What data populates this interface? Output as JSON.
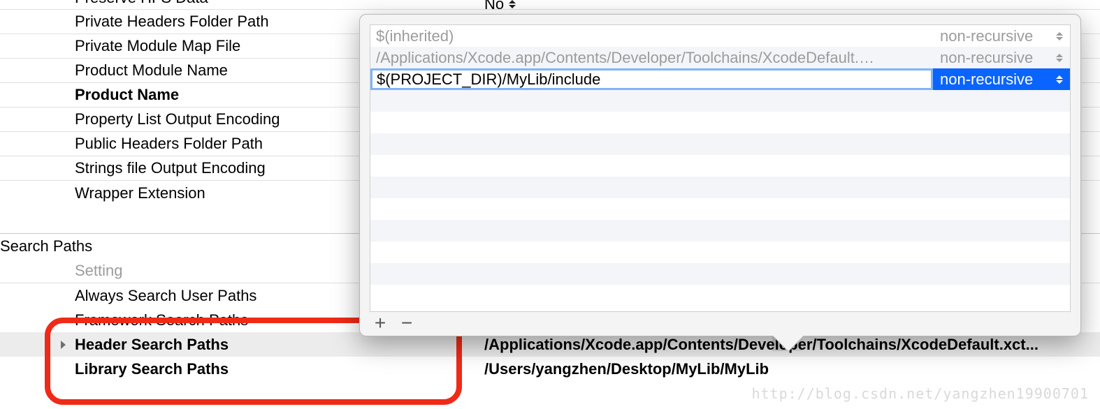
{
  "top_dropdown": {
    "value": "No"
  },
  "settings": {
    "rows": [
      {
        "label": "Preserve HFS Data",
        "bold": false
      },
      {
        "label": "Private Headers Folder Path",
        "bold": false
      },
      {
        "label": "Private Module Map File",
        "bold": false
      },
      {
        "label": "Product Module Name",
        "bold": false
      },
      {
        "label": "Product Name",
        "bold": true
      },
      {
        "label": "Property List Output Encoding",
        "bold": false
      },
      {
        "label": "Public Headers Folder Path",
        "bold": false
      },
      {
        "label": "Strings file Output Encoding",
        "bold": false
      },
      {
        "label": "Wrapper Extension",
        "bold": false
      }
    ]
  },
  "section": {
    "title": "Search Paths",
    "subtitle": "Setting",
    "items": [
      {
        "label": "Always Search User Paths",
        "bold": false,
        "value": "",
        "has_tri": false,
        "selected": false
      },
      {
        "label": "Framework Search Paths",
        "bold": false,
        "value": "",
        "has_tri": false,
        "selected": false
      },
      {
        "label": "Header Search Paths",
        "bold": true,
        "value": "/Applications/Xcode.app/Contents/Developer/Toolchains/XcodeDefault.xct...",
        "has_tri": true,
        "selected": true
      },
      {
        "label": "Library Search Paths",
        "bold": true,
        "value": "/Users/yangzhen/Desktop/MyLib/MyLib",
        "has_tri": false,
        "selected": false
      }
    ]
  },
  "popover": {
    "rows": [
      {
        "path": "$(inherited)",
        "recursive": "non-recursive",
        "inactive": true,
        "editing": false
      },
      {
        "path": "/Applications/Xcode.app/Contents/Developer/Toolchains/XcodeDefault.…",
        "recursive": "non-recursive",
        "inactive": true,
        "editing": false
      },
      {
        "path": "$(PROJECT_DIR)/MyLib/include",
        "recursive": "non-recursive",
        "inactive": false,
        "editing": true
      }
    ],
    "add_label": "+",
    "remove_label": "−"
  },
  "watermark": "http://blog.csdn.net/yangzhen19900701"
}
